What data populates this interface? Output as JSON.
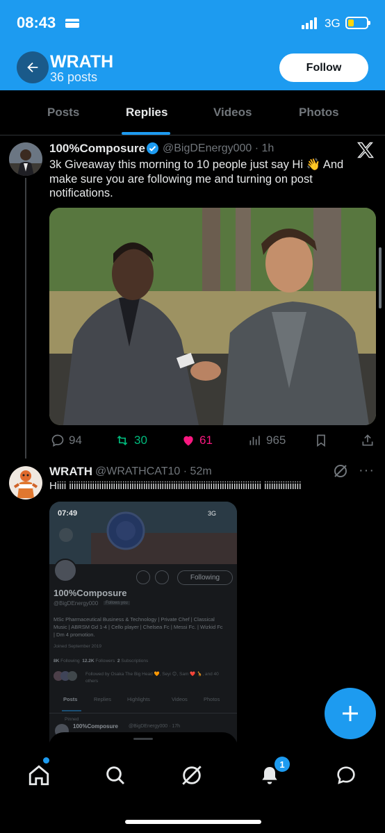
{
  "status_bar": {
    "time": "08:43",
    "network": "3G"
  },
  "header": {
    "name": "WRATH",
    "post_count": "36 posts",
    "follow_label": "Follow"
  },
  "tabs": [
    {
      "label": "Posts",
      "active": false
    },
    {
      "label": "Replies",
      "active": true
    },
    {
      "label": "Videos",
      "active": false
    },
    {
      "label": "Photos",
      "active": false
    }
  ],
  "tweet1": {
    "author": "100%Composure",
    "handle": "@BigDEnergy000 · 1h",
    "text_line1": "3k Giveaway this morning  to 10 people just say Hi 👋 And",
    "text_line2": "make sure you are following me and turning on post",
    "text_line3": "notifications.",
    "replies": "94",
    "retweets": "30",
    "likes": "61",
    "views": "965",
    "retweet_color": "#00ba7c",
    "like_color": "#f91880"
  },
  "tweet2": {
    "author": "WRATH",
    "handle": "@WRATHCAT10 · 52m",
    "text": "Hiiii iiiiiiiiiiiiiiiiiiiiiiiiiiiiiiiiiiiiiiiiiiiiiiiiiiiiiiiiiiiiiiiiiiiiiiiiiiiiiiiiiii iiiiiiiiiiiiiiii"
  },
  "embedded_screenshot": {
    "time": "07:49",
    "network": "3G",
    "following_label": "Following",
    "name": "100%Composure",
    "handle": "@BigDEnergy000",
    "follows_you": "Follows you",
    "bio_line1": "MSc Pharmaceutical Business & Technology | Private Chef | Classical",
    "bio_line2": "Music | ABRSM Gd 1-4 | Cello player | Chelsea Fc | Messi Fc. | Wizkid Fc",
    "bio_line3": "| Dm 4 promotion.",
    "joined": "Joined September 2019",
    "following_count": "8K",
    "following_word": "Following",
    "followers_count": "12.2K",
    "followers_word": "Followers",
    "subscriptions_count": "2",
    "subscriptions_word": "Subscriptions",
    "followed_by": "Followed by Osaka The Big Head 🧡, Seyi 😊, Sam ❤️ 🦒, and 40",
    "followed_by_2": "others",
    "tabs": [
      "Posts",
      "Replies",
      "Highlights",
      "Videos",
      "Photos"
    ],
    "pinned": "Pinned",
    "pinned_author": "100%Composure",
    "pinned_handle": "@BigDEnergy000 · 17h"
  },
  "notifications_badge": "1",
  "brand_color": "#1d9bf0"
}
